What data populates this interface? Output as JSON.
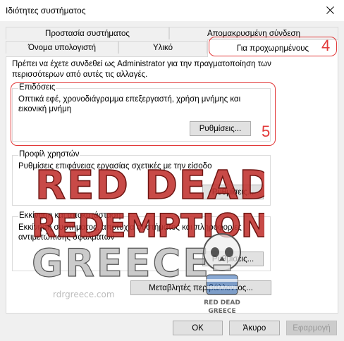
{
  "window": {
    "title": "Ιδιότητες συστήματος"
  },
  "tabs": {
    "row1": [
      "Προστασία συστήματος",
      "Απομακρυσμένη σύνδεση"
    ],
    "row2": [
      "Όνομα υπολογιστή",
      "Υλικό",
      "Για προχωρημένους"
    ]
  },
  "intro": "Πρέπει να έχετε συνδεθεί ως Administrator για την πραγματοποίηση των περισσότερων από αυτές τις αλλαγές.",
  "performance": {
    "title": "Επιδόσεις",
    "desc": "Οπτικά εφέ, χρονοδιάγραμμα επεξεργαστή, χρήση μνήμης και εικονική μνήμη",
    "button": "Ρυθμίσεις..."
  },
  "profiles": {
    "title": "Προφίλ χρηστών",
    "desc": "Ρυθμίσεις επιφάνειας εργασίας σχετικές με την είσοδο",
    "button": "Ρυθμίσεις..."
  },
  "startup": {
    "title": "Εκκίνηση και αποκατάσταση",
    "desc": "Εκκίνηση συστήματος, αποτυχία συστήματος και πληροφορίες αντιμετώπισης σφαλμάτων",
    "button": "Ρυθμίσεις..."
  },
  "env_button": "Μεταβλητές περιβάλλοντος...",
  "footer": {
    "ok": "OK",
    "cancel": "Άκυρο",
    "apply": "Εφαρμογή"
  },
  "annotations": {
    "tab_number": "4",
    "group_number": "5",
    "color": "#e23a3a"
  },
  "watermark": {
    "line1": "RED DEAD",
    "line2": "REDEMPTION",
    "line3": "GREECE",
    "url": "rdrgreece.com",
    "badge_top": "RED DEAD",
    "badge_bottom": "GREECE"
  }
}
